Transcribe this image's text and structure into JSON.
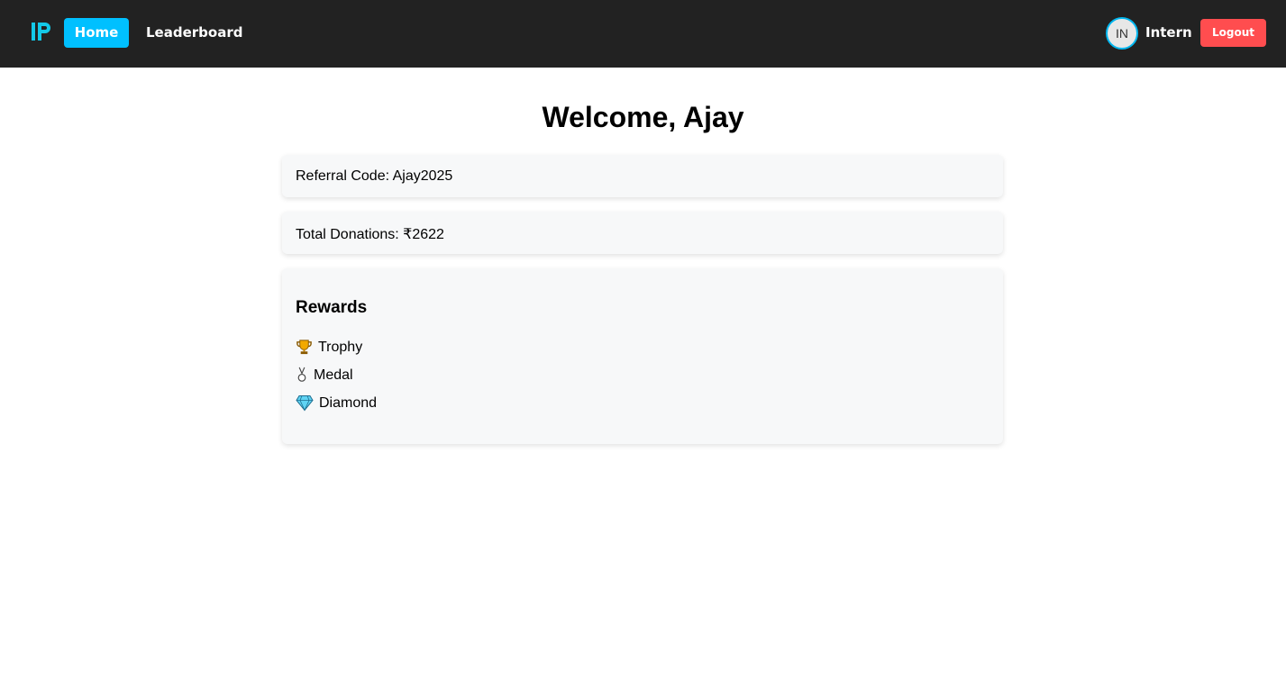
{
  "nav": {
    "logo_text": "IP",
    "home_label": "Home",
    "leaderboard_label": "Leaderboard",
    "avatar_initials": "IN",
    "username": "Intern",
    "logout_label": "Logout"
  },
  "main": {
    "title": "Welcome, Ajay",
    "referral_text": "Referral Code: Ajay2025",
    "donations_text": "Total Donations: ₹2622",
    "rewards": {
      "heading": "Rewards",
      "items": [
        {
          "icon": "trophy-icon",
          "label": "Trophy"
        },
        {
          "icon": "medal-icon",
          "label": "Medal"
        },
        {
          "icon": "diamond-icon",
          "label": "Diamond"
        }
      ]
    }
  },
  "colors": {
    "navbar_bg": "#222222",
    "accent": "#00c0ff",
    "logout": "#ff4d4f",
    "card_bg": "#f7f8f9"
  }
}
